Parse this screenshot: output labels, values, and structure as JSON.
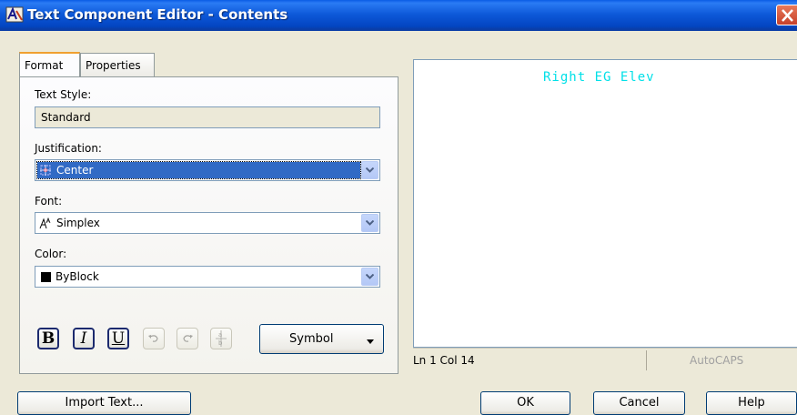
{
  "window": {
    "title": "Text Component Editor - Contents",
    "icon": "app-icon",
    "close_icon": "close-icon"
  },
  "tabs": [
    {
      "label": "Format",
      "active": true
    },
    {
      "label": "Properties",
      "active": false
    }
  ],
  "format": {
    "text_style_label": "Text Style:",
    "text_style_value": "Standard",
    "justification_label": "Justification:",
    "justification_value": "Center",
    "justification_icon": "justify-center-icon",
    "font_label": "Font:",
    "font_value": "Simplex",
    "font_icon": "shx-font-icon",
    "color_label": "Color:",
    "color_value": "ByBlock",
    "color_swatch": "#000000",
    "buttons": {
      "bold": "B",
      "italic": "I",
      "underline": "U",
      "undo_icon": "undo-icon",
      "redo_icon": "redo-icon",
      "stack_icon": "stack-fraction-icon",
      "stack_glyph": "a/b"
    },
    "symbol_label": "Symbol"
  },
  "preview": {
    "text": "Right EG Elev",
    "text_color": "#00e0e8",
    "status_position": "Ln 1 Col 14",
    "status_mode": "AutoCAPS"
  },
  "footer": {
    "import_text": "Import Text...",
    "ok": "OK",
    "cancel": "Cancel",
    "help": "Help"
  }
}
